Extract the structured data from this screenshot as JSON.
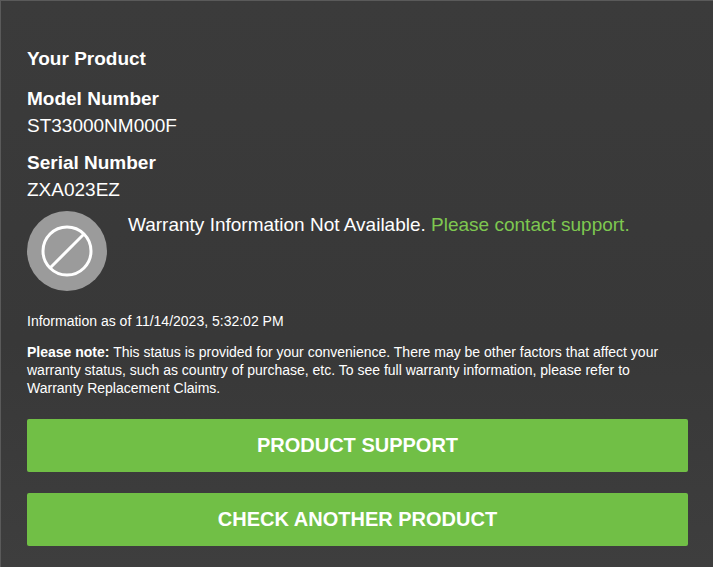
{
  "product": {
    "heading": "Your Product",
    "model_label": "Model Number",
    "model": "ST33000NM000F",
    "serial_label": "Serial Number",
    "serial": "ZXA023EZ"
  },
  "warranty": {
    "status": "Warranty Information Not Available.",
    "link": "Please contact support."
  },
  "timestamp": "Information as of 11/14/2023, 5:32:02 PM",
  "note": {
    "label": "Please note:",
    "text": "This status is provided for your convenience. There may be other factors that affect your warranty status, such as country of purchase, etc. To see full warranty information, please refer to Warranty Replacement Claims."
  },
  "buttons": [
    "PRODUCT SUPPORT",
    "CHECK ANOTHER PRODUCT"
  ]
}
